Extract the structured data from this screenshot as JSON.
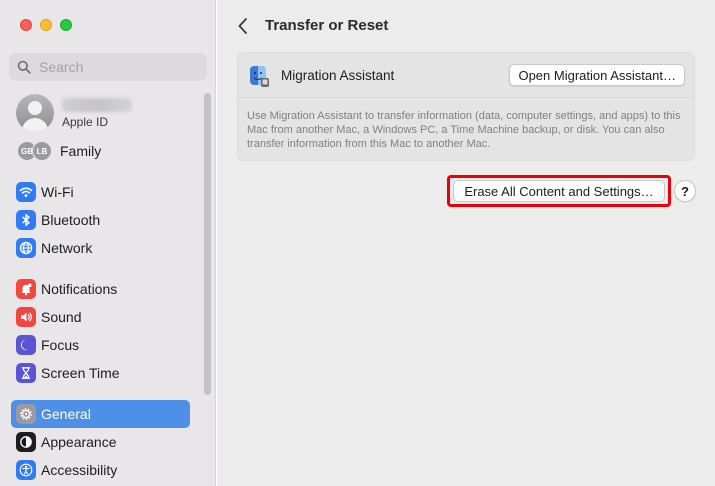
{
  "window": {
    "title": "Transfer or Reset"
  },
  "search": {
    "placeholder": "Search"
  },
  "account": {
    "subtitle": "Apple ID"
  },
  "family": {
    "label": "Family",
    "members": [
      "GB",
      "LB"
    ]
  },
  "sidebar": {
    "items": [
      {
        "label": "Wi-Fi",
        "icon": "wifi-icon",
        "color": "#2f7cf6"
      },
      {
        "label": "Bluetooth",
        "icon": "bluetooth-icon",
        "color": "#2f7cf6"
      },
      {
        "label": "Network",
        "icon": "globe-icon",
        "color": "#2f7cf6"
      },
      {
        "label": "Notifications",
        "icon": "bell-icon",
        "color": "#f0473f"
      },
      {
        "label": "Sound",
        "icon": "speaker-icon",
        "color": "#f0473f"
      },
      {
        "label": "Focus",
        "icon": "moon-icon",
        "color": "#5b55d6"
      },
      {
        "label": "Screen Time",
        "icon": "hourglass-icon",
        "color": "#5b55d6"
      },
      {
        "label": "General",
        "icon": "gear-icon",
        "color": "#8e8e93",
        "selected": true
      },
      {
        "label": "Appearance",
        "icon": "appearance-icon",
        "color": "#1d1d1f"
      },
      {
        "label": "Accessibility",
        "icon": "accessibility-icon",
        "color": "#2f7cf6"
      }
    ]
  },
  "migration": {
    "label": "Migration Assistant",
    "button": "Open Migration Assistant…",
    "description": "Use Migration Assistant to transfer information (data, computer settings, and apps) to this Mac from another Mac, a Windows PC, a Time Machine backup, or disk. You can also transfer information from this Mac to another Mac."
  },
  "erase": {
    "button": "Erase All Content and Settings…",
    "highlight_color": "#e8000b"
  },
  "help": {
    "label": "?"
  },
  "colors": {
    "accent": "#4e8fe8",
    "sidebar_bg": "#e8e6e8",
    "main_bg": "#ececec"
  }
}
